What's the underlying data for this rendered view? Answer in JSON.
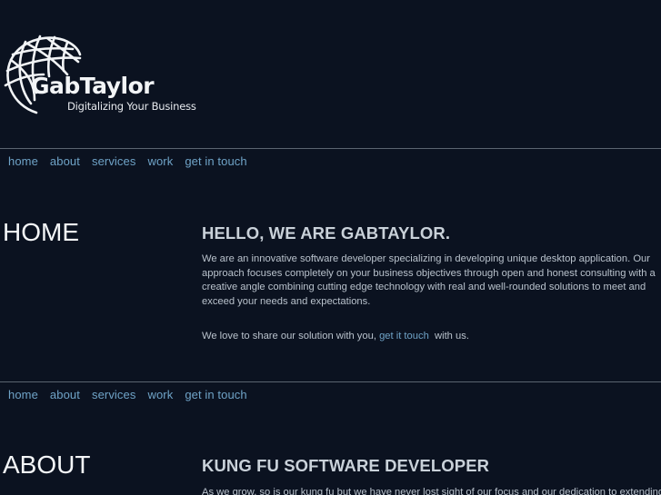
{
  "brand": {
    "name": "GabTaylor",
    "tagline": "Digitalizing Your Business",
    "logo_icon": "wireframe-globe-icon"
  },
  "nav": {
    "items": [
      {
        "label": "home"
      },
      {
        "label": "about"
      },
      {
        "label": "services"
      },
      {
        "label": "work"
      },
      {
        "label": "get in touch"
      }
    ]
  },
  "home": {
    "title": "HOME",
    "heading": "HELLO, WE ARE GABTAYLOR.",
    "paragraph1": "We are an innovative software developer specializing in developing unique desktop application. Our approach focuses completely on your business objectives through open and honest consulting with a creative angle combining cutting edge technology with real and well-rounded solutions to meet and exceed your needs and expectations.",
    "share_prefix": "We love to share our solution with you, ",
    "share_link": "get it touch",
    "share_suffix": "  with us."
  },
  "about": {
    "title": "ABOUT",
    "heading": "KUNG FU SOFTWARE DEVELOPER",
    "paragraph1": "As we grow, so is our kung fu but we have never lost sight of our focus and our dedication to extending"
  },
  "colors": {
    "background": "#0b1220",
    "link": "#6fa3c7",
    "heading": "#c9d1d9",
    "text": "#b9c2cc",
    "divider": "#5b6470"
  }
}
